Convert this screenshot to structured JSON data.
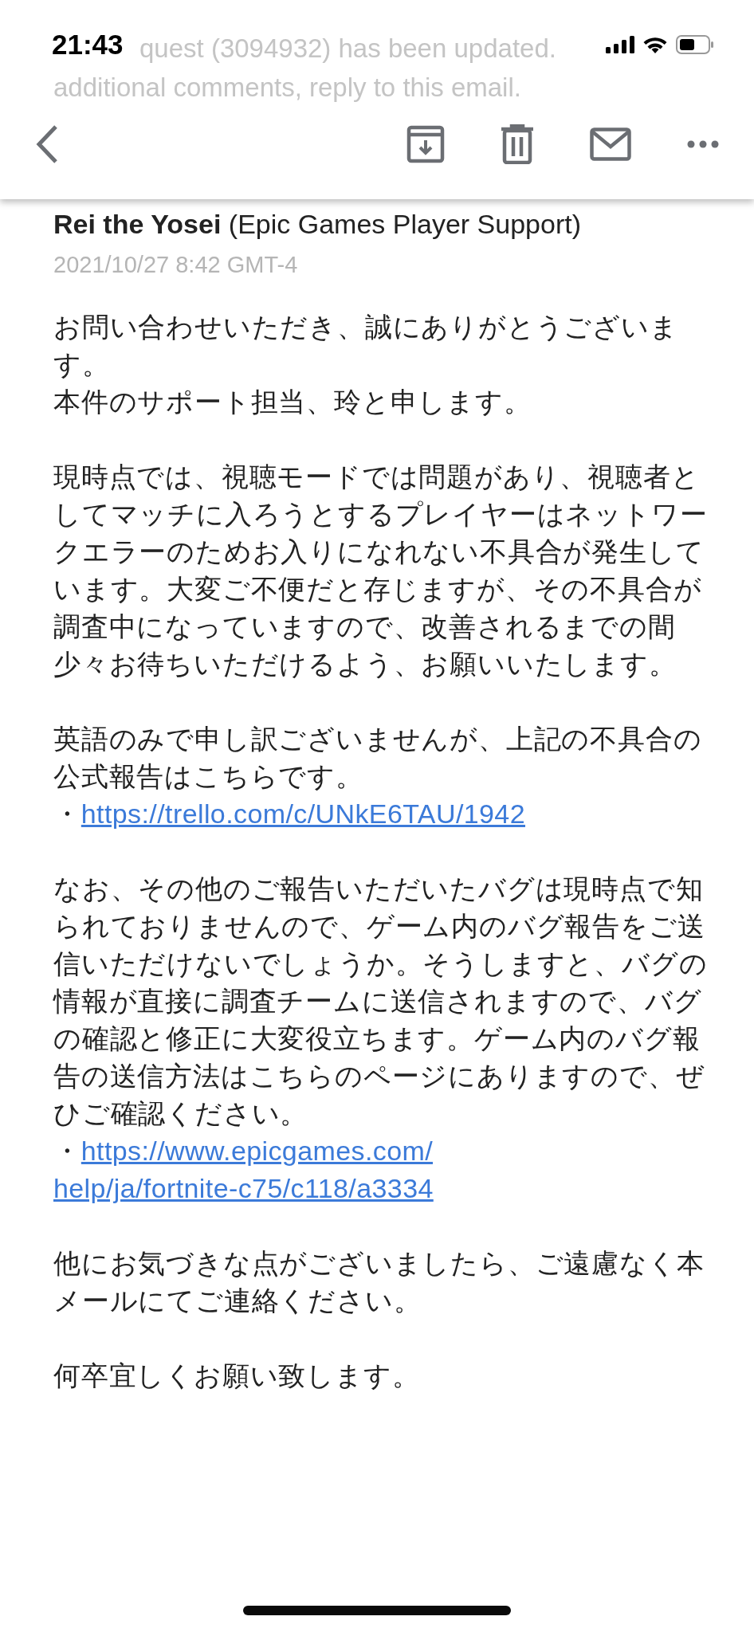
{
  "status_bar": {
    "time": "21:43"
  },
  "email": {
    "behind_header": [
      {
        "kind": "indented",
        "text": "quest (3094932) has been updated."
      },
      {
        "kind": "plain",
        "text": "additional comments, reply to this email."
      }
    ],
    "sender_name": "Rei the Yosei",
    "sender_org": "(Epic Games Player Support)",
    "date": "2021/10/27 8:42 GMT-4",
    "body": [
      {
        "kind": "text",
        "text": "お問い合わせいただき、誠にありがとうございます。"
      },
      {
        "kind": "text",
        "text": "本件のサポート担当、玲と申します。"
      },
      {
        "kind": "gap"
      },
      {
        "kind": "text",
        "text": "現時点では、視聴モードでは問題があり、視聴者としてマッチに入ろうとするプレイヤーはネットワークエラーのためお入りになれない不具合が発生しています。大変ご不便だと存じますが、その不具合が調査中になっていますので、改善されるまでの間"
      },
      {
        "kind": "text",
        "text": "少々お待ちいただけるよう、お願いいたします。"
      },
      {
        "kind": "gap"
      },
      {
        "kind": "text",
        "text": "英語のみで申し訳ございませんが、上記の不具合の公式報告はこちらです。"
      },
      {
        "kind": "link",
        "bullet": "・",
        "lines": [
          "https://trello.com/c/UNkE6TAU/1942"
        ]
      },
      {
        "kind": "gap"
      },
      {
        "kind": "text",
        "text": "なお、その他のご報告いただいたバグは現時点で知られておりませんので、ゲーム内のバグ報告をご送信いただけないでしょうか。そうしますと、バグの情報が直接に調査チームに送信されますので、バグの確認と修正に大変役立ちます。ゲーム内のバグ報告の送信方法はこちらのページにありますので、ぜひご確認ください。"
      },
      {
        "kind": "link",
        "bullet": "・",
        "lines": [
          "https://www.epicgames.com/",
          "help/ja/fortnite-c75/c118/a3334"
        ]
      },
      {
        "kind": "gap"
      },
      {
        "kind": "text",
        "text": "他にお気づきな点がございましたら、ご遠慮なく本メールにてご連絡ください。"
      },
      {
        "kind": "gap"
      },
      {
        "kind": "text",
        "text": "何卒宜しくお願い致します。"
      }
    ]
  }
}
